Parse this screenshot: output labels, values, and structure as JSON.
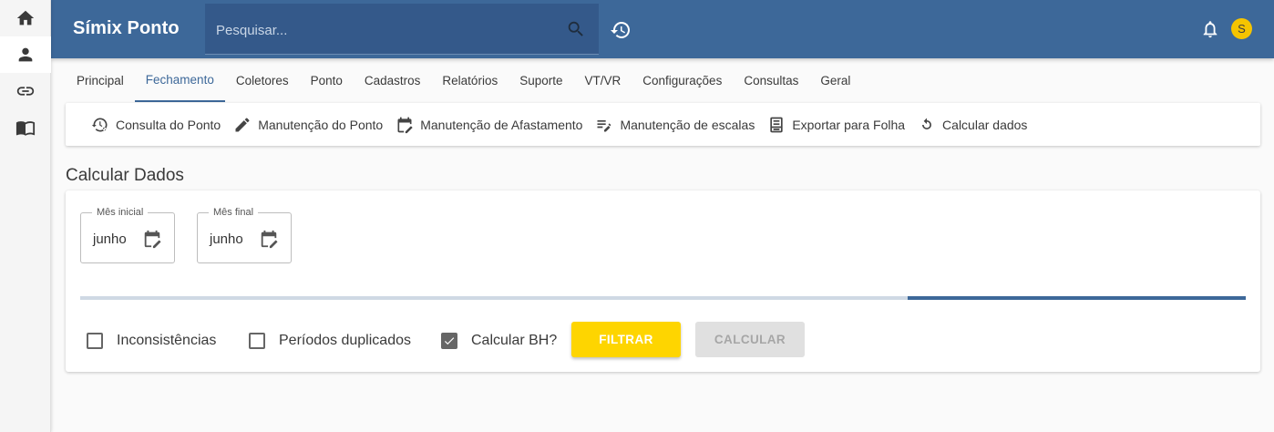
{
  "header": {
    "brand": "Símix Ponto",
    "search_placeholder": "Pesquisar...",
    "avatar_initial": "S",
    "bar_color": "#3d6899"
  },
  "rail": {
    "items": [
      {
        "icon": "home-icon"
      },
      {
        "icon": "person-icon"
      },
      {
        "icon": "link-icon"
      },
      {
        "icon": "book-icon"
      }
    ]
  },
  "tabs": [
    {
      "label": "Principal"
    },
    {
      "label": "Fechamento",
      "active": true
    },
    {
      "label": "Coletores"
    },
    {
      "label": "Ponto"
    },
    {
      "label": "Cadastros"
    },
    {
      "label": "Relatórios"
    },
    {
      "label": "Suporte"
    },
    {
      "label": "VT/VR"
    },
    {
      "label": "Configurações"
    },
    {
      "label": "Consultas"
    },
    {
      "label": "Geral"
    }
  ],
  "subnav": [
    {
      "label": "Consulta do Ponto",
      "icon": "history-settings-icon"
    },
    {
      "label": "Manutenção do Ponto",
      "icon": "pencil-icon"
    },
    {
      "label": "Manutenção de Afastamento",
      "icon": "calendar-edit-icon"
    },
    {
      "label": "Manutenção de escalas",
      "icon": "list-edit-icon"
    },
    {
      "label": "Exportar para Folha",
      "icon": "document-icon"
    },
    {
      "label": "Calcular dados",
      "icon": "refresh-icon"
    }
  ],
  "page": {
    "title": "Calcular Dados"
  },
  "form": {
    "start_month": {
      "label": "Mês inicial",
      "value": "junho"
    },
    "end_month": {
      "label": "Mês final",
      "value": "junho"
    },
    "progress_fraction": 0.29,
    "checkboxes": [
      {
        "label": "Inconsistências",
        "checked": false
      },
      {
        "label": "Períodos duplicados",
        "checked": false
      },
      {
        "label": "Calcular BH?",
        "checked": true
      }
    ],
    "filter_button": "FILTRAR",
    "calculate_button": "CALCULAR",
    "accent": "#fed500"
  }
}
